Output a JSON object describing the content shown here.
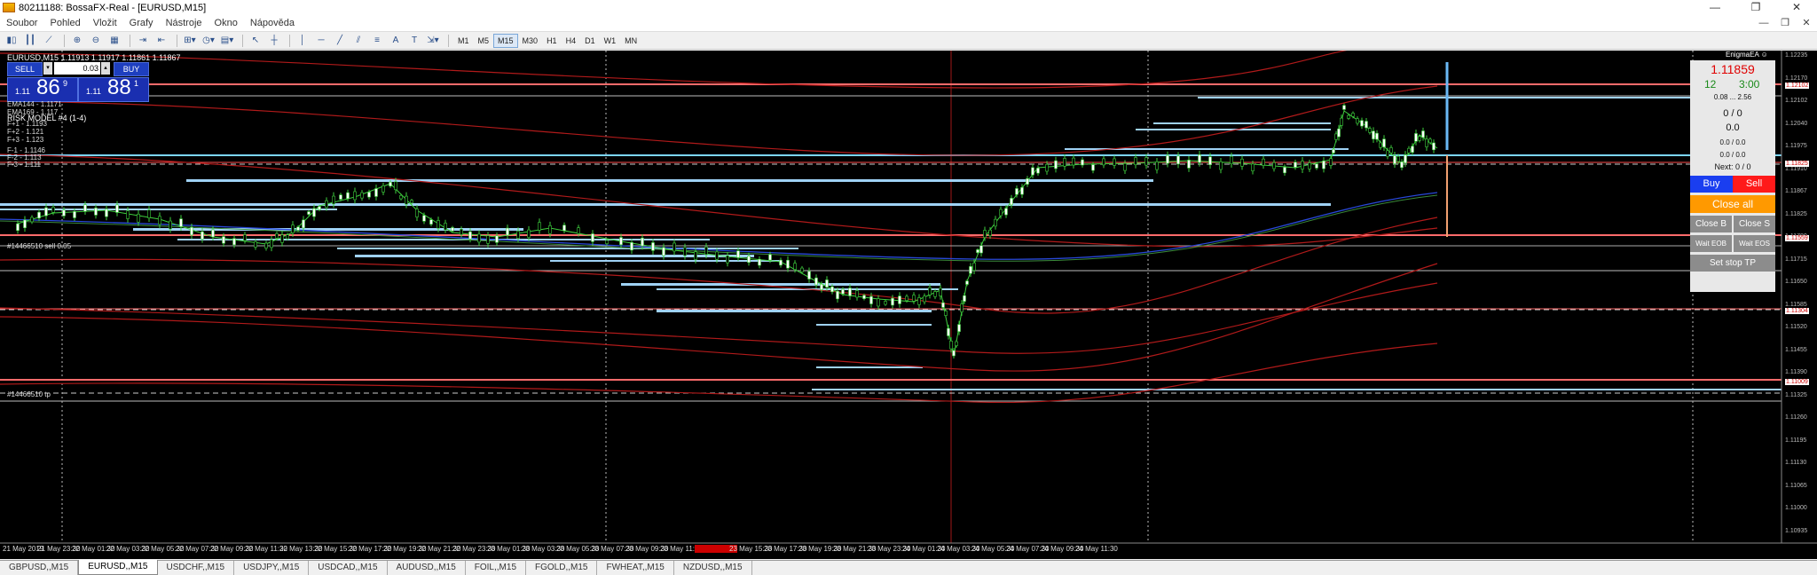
{
  "window": {
    "title": "80211188: BossaFX-Real - [EURUSD,M15]",
    "controls": [
      "—",
      "❐",
      "✕"
    ]
  },
  "menu": {
    "items": [
      "Soubor",
      "Pohled",
      "Vložit",
      "Grafy",
      "Nástroje",
      "Okno",
      "Nápověda"
    ],
    "mdi_controls": [
      "—",
      "❐",
      "✕"
    ]
  },
  "toolbar": {
    "timeframes": [
      "M1",
      "M5",
      "M15",
      "M30",
      "H1",
      "H4",
      "D1",
      "W1",
      "MN"
    ],
    "active_timeframe": "M15"
  },
  "chart": {
    "symbol_line": "EURUSD,M15  1.11913 1.11917 1.11861 1.11867",
    "risk_model": "RISK MODEL #4 (1-4)",
    "ema144": "EMA144 - 1.1171",
    "ema169": "EMA169 - 1.117",
    "fib_plus": [
      "F+1 - 1.1193",
      "F+2 - 1.121",
      "F+3 - 1.123"
    ],
    "fib_minus": [
      "F-1 - 1.1146",
      "F-2 - 1.113",
      "F-3 - 1.111"
    ],
    "trade_label_1": "#14466510 sell 0.05",
    "trade_label_2": "#14466510 tp",
    "one_click": {
      "sell_label": "SELL",
      "buy_label": "BUY",
      "volume": "0.03",
      "sell_price_small": "1.11",
      "sell_price_big": "86",
      "sell_price_sup": "9",
      "buy_price_small": "1.11",
      "buy_price_big": "88",
      "buy_price_sup": "1"
    },
    "ea_title": "EnigmaEA",
    "ea": {
      "price": "1.11859",
      "count": "12",
      "time": "3:00",
      "range": "0.08 ... 2.56",
      "pos": "0 / 0",
      "pl": "0.0",
      "r1": "0.0 / 0.0",
      "r2": "0.0 / 0.0",
      "next": "Next: 0 / 0",
      "buy": "Buy",
      "sell": "Sell",
      "close_all": "Close all",
      "close_b": "Close B",
      "close_s": "Close S",
      "wait_eob": "Wait EOB",
      "wait_eos": "Wait EOS",
      "set_stop_tp": "Set stop TP",
      "colors": {
        "price": "#e00000",
        "green": "#1a8a1a",
        "buy": "#1a3ef0",
        "sell": "#ff1a1a",
        "close_all": "#ff9900",
        "gray_btn": "#8c8c8c"
      }
    },
    "y_axis": [
      "1.12235",
      "1.12170",
      "1.12102",
      "1.12040",
      "1.11975",
      "1.11910",
      "1.11867",
      "1.11825",
      "1.11780",
      "1.11715",
      "1.11650",
      "1.11585",
      "1.11520",
      "1.11455",
      "1.11390",
      "1.11325",
      "1.11260",
      "1.11195",
      "1.11130",
      "1.11065",
      "1.11000",
      "1.10935"
    ],
    "y_axis_highlight": [
      "1.12102",
      "1.11825",
      "1.11559",
      "1.11304",
      "1.11009"
    ],
    "x_axis": [
      "21 May 2019",
      "21 May 23:30",
      "22 May 01:30",
      "22 May 03:30",
      "22 May 05:30",
      "22 May 07:30",
      "22 May 09:30",
      "22 May 11:30",
      "22 May 13:30",
      "22 May 15:30",
      "22 May 17:30",
      "22 May 19:30",
      "22 May 21:30",
      "22 May 23:30",
      "23 May 01:30",
      "23 May 03:30",
      "23 May 05:30",
      "23 May 07:30",
      "23 May 09:30",
      "23 May 11:30",
      "23 May 13:30",
      "23 May 15:30",
      "23 May 17:30",
      "23 May 19:30",
      "23 May 21:30",
      "23 May 23:30",
      "24 May 01:30",
      "24 May 03:30",
      "24 May 05:30",
      "24 May 07:30",
      "24 May 09:30",
      "24 May 11:30"
    ],
    "x_axis_highlight_index": 20
  },
  "tabs": {
    "items": [
      "GBPUSD,,M15",
      "EURUSD,,M15",
      "USDCHF,,M15",
      "USDJPY,,M15",
      "USDCAD,,M15",
      "AUDUSD,,M15",
      "FOIL,,M15",
      "FGOLD,,M15",
      "FWHEAT,,M15",
      "NZDUSD,,M15"
    ],
    "active_index": 1
  }
}
